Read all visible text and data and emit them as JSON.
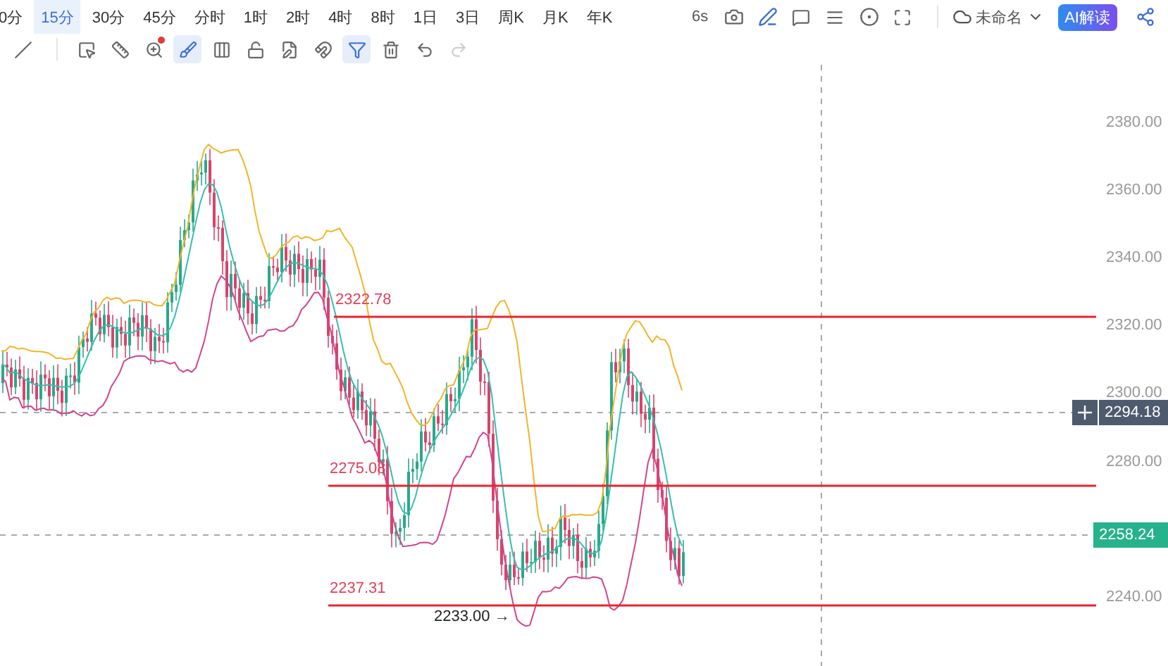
{
  "timeframes": [
    {
      "label": "0分",
      "selected": false
    },
    {
      "label": "15分",
      "selected": true
    },
    {
      "label": "30分",
      "selected": false
    },
    {
      "label": "45分",
      "selected": false
    },
    {
      "label": "分时",
      "selected": false
    },
    {
      "label": "1时",
      "selected": false
    },
    {
      "label": "2时",
      "selected": false
    },
    {
      "label": "4时",
      "selected": false
    },
    {
      "label": "8时",
      "selected": false
    },
    {
      "label": "1日",
      "selected": false
    },
    {
      "label": "3日",
      "selected": false
    },
    {
      "label": "周K",
      "selected": false
    },
    {
      "label": "月K",
      "selected": false
    },
    {
      "label": "年K",
      "selected": false
    }
  ],
  "top_tools": {
    "refresh": "6s",
    "layout_name": "未命名",
    "ai_button": "AI解读"
  },
  "drawing_tools": [
    {
      "kind": "line",
      "selected": false,
      "notify": false,
      "disabled": false
    },
    {
      "kind": "frame",
      "selected": false,
      "notify": false,
      "disabled": false
    },
    {
      "kind": "ruler",
      "selected": false,
      "notify": false,
      "disabled": false
    },
    {
      "kind": "zoom",
      "selected": false,
      "notify": true,
      "disabled": false
    },
    {
      "kind": "brush",
      "selected": true,
      "notify": false,
      "disabled": false
    },
    {
      "kind": "bars",
      "selected": false,
      "notify": false,
      "disabled": false
    },
    {
      "kind": "lock",
      "selected": false,
      "notify": false,
      "disabled": false
    },
    {
      "kind": "note",
      "selected": false,
      "notify": false,
      "disabled": false
    },
    {
      "kind": "magnet",
      "selected": false,
      "notify": false,
      "disabled": false
    },
    {
      "kind": "filter",
      "selected": true,
      "notify": false,
      "disabled": false
    },
    {
      "kind": "trash",
      "selected": false,
      "notify": false,
      "disabled": false
    },
    {
      "kind": "undo",
      "selected": false,
      "notify": false,
      "disabled": false
    },
    {
      "kind": "redo",
      "selected": false,
      "notify": false,
      "disabled": true
    }
  ],
  "chart": {
    "y_axis_ticks": [
      "2380.00",
      "2360.00",
      "2340.00",
      "2320.00",
      "2300.00",
      "2280.00",
      "2240.00"
    ],
    "levels": [
      {
        "label": "2322.78"
      },
      {
        "label": "2275.08"
      },
      {
        "label": "2237.31"
      }
    ],
    "low_marker": "2233.00 →",
    "crosshair_price": "2294.18",
    "last_price": "2258.24"
  }
}
